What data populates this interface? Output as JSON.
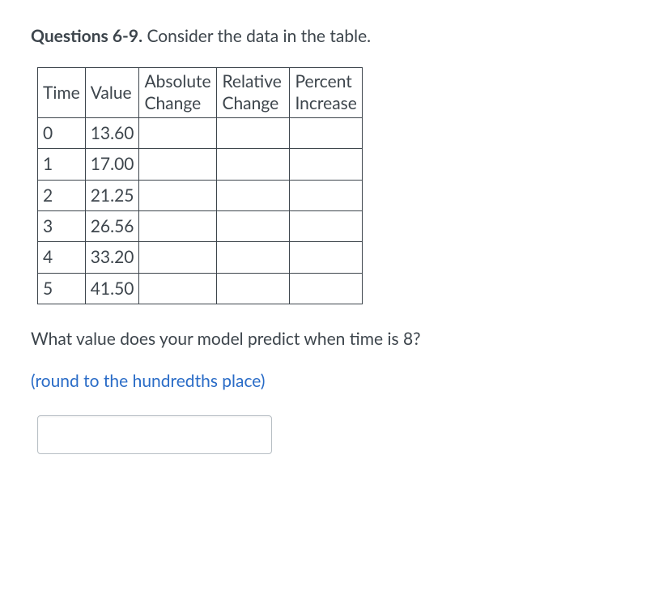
{
  "heading": {
    "bold": "Questions 6-9.",
    "rest": " Consider the data in the table."
  },
  "table": {
    "headers": {
      "time": "Time",
      "value": "Value",
      "abs_l1": "Absolute",
      "abs_l2": "Change",
      "rel_l1": "Relative",
      "rel_l2": "Change",
      "pct_l1": "Percent",
      "pct_l2": "Increase"
    },
    "rows": [
      {
        "time": "0",
        "value": "13.60",
        "abs": "",
        "rel": "",
        "pct": ""
      },
      {
        "time": "1",
        "value": "17.00",
        "abs": "",
        "rel": "",
        "pct": ""
      },
      {
        "time": "2",
        "value": "21.25",
        "abs": "",
        "rel": "",
        "pct": ""
      },
      {
        "time": "3",
        "value": "26.56",
        "abs": "",
        "rel": "",
        "pct": ""
      },
      {
        "time": "4",
        "value": "33.20",
        "abs": "",
        "rel": "",
        "pct": ""
      },
      {
        "time": "5",
        "value": "41.50",
        "abs": "",
        "rel": "",
        "pct": ""
      }
    ]
  },
  "question": "What value does your model predict when time is 8?",
  "instruction_open": "(",
  "instruction_text": "round to the hundredths place",
  "instruction_close": ")",
  "answer": {
    "value": "",
    "placeholder": ""
  }
}
